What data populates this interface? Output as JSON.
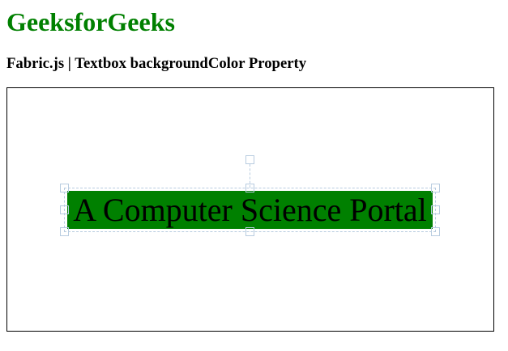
{
  "page": {
    "title": "GeeksforGeeks",
    "subtitle": "Fabric.js | Textbox backgroundColor Property"
  },
  "canvas": {
    "textbox": {
      "text": "A Computer Science Portal",
      "background_color": "green",
      "text_color": "#000000",
      "selected": true
    },
    "selection_color": "#b8cce0"
  }
}
